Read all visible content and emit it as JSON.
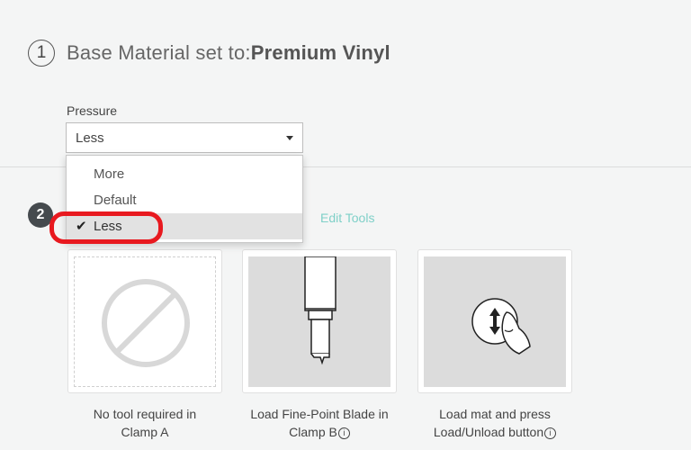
{
  "step1": {
    "number": "1",
    "title_prefix": "Base Material set to:",
    "material": "Premium Vinyl"
  },
  "pressure": {
    "label": "Pressure",
    "selected": "Less",
    "options": [
      {
        "label": "More",
        "checked": false
      },
      {
        "label": "Default",
        "checked": false
      },
      {
        "label": "Less",
        "checked": true
      }
    ]
  },
  "step2": {
    "number": "2",
    "edit_tools_label": "Edit Tools"
  },
  "tools": [
    {
      "caption_line1": "No tool required in",
      "caption_line2": "Clamp A",
      "icon": "no-tool-icon"
    },
    {
      "caption_line1": "Load Fine-Point Blade in",
      "caption_line2": "Clamp B",
      "icon": "fine-point-blade-icon"
    },
    {
      "caption_line1": "Load mat and press",
      "caption_line2": "Load/Unload button",
      "icon": "load-unload-button-icon"
    }
  ],
  "colors": {
    "highlight": "#e8191f",
    "edit_tools": "#7fd0c8",
    "step2_badge": "#454a4e"
  }
}
